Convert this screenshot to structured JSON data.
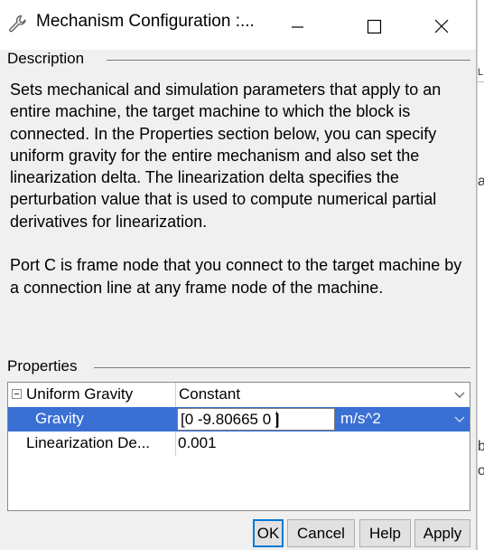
{
  "window": {
    "title": "Mechanism Configuration :...",
    "icons": [
      "wrench-icon",
      "minimize-icon",
      "maximize-icon",
      "close-icon"
    ]
  },
  "description": {
    "heading": "Description",
    "text": "Sets mechanical and simulation parameters that apply to an entire machine, the target machine to which the block is connected. In the Properties section below, you can specify uniform gravity for the entire mechanism and also set the linearization delta. The linearization delta specifies the perturbation value that is used to compute numerical partial derivatives for linearization.\n\nPort C is frame node that you connect to the target machine by a connection line at any frame node of the machine."
  },
  "properties": {
    "heading": "Properties",
    "rows": [
      {
        "name": "Uniform Gravity",
        "value": "Constant"
      },
      {
        "name": "Gravity",
        "value": "[0 -9.80665 0 ]",
        "unit": "m/s^2"
      },
      {
        "name": "Linearization De...",
        "value": "0.001"
      }
    ]
  },
  "buttons": {
    "ok": "OK",
    "cancel": "Cancel",
    "help": "Help",
    "apply": "Apply"
  },
  "background": {
    "chars": [
      "L",
      "a",
      "b",
      "o"
    ]
  },
  "colors": {
    "selection": "#3a6fd4",
    "default_button_border": "#0078d7"
  }
}
